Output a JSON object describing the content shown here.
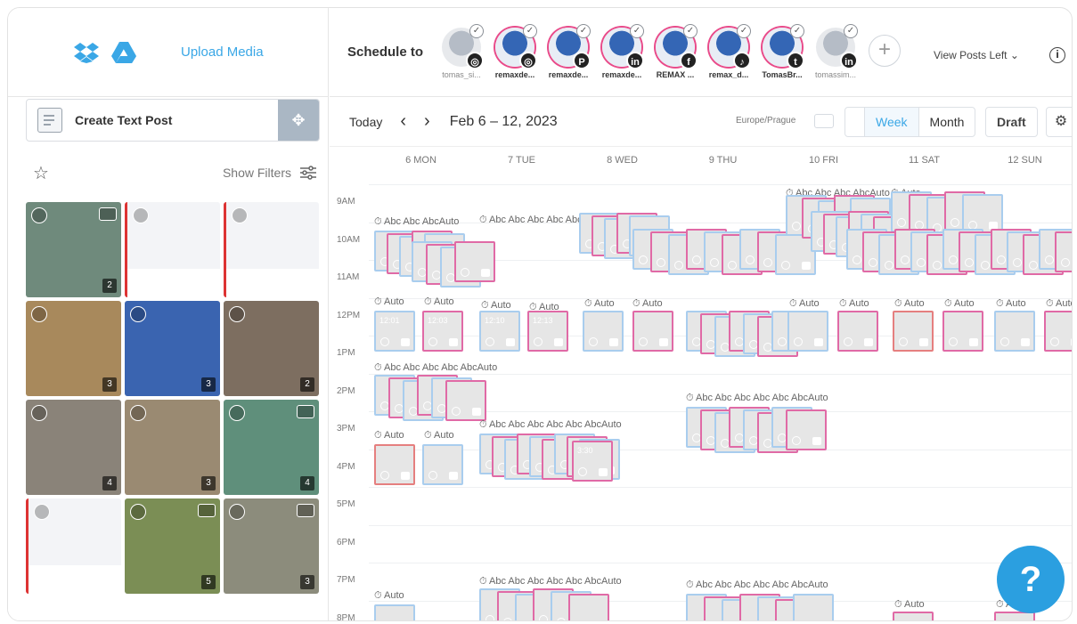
{
  "sidebar": {
    "upload_label": "Upload Media",
    "create_text_post": "Create Text Post",
    "show_filters": "Show Filters",
    "media_tiles": [
      {
        "count": "2",
        "video": true,
        "color": "#6f8a7c"
      },
      {
        "count": "",
        "video": false,
        "color": "#f3f4f7"
      },
      {
        "count": "",
        "video": false,
        "color": "#f3f4f7"
      },
      {
        "count": "3",
        "video": false,
        "color": "#a8895c"
      },
      {
        "count": "3",
        "video": false,
        "color": "#3a64b0"
      },
      {
        "count": "2",
        "video": false,
        "color": "#7d6e60"
      },
      {
        "count": "4",
        "video": false,
        "color": "#8a8379"
      },
      {
        "count": "3",
        "video": false,
        "color": "#9a8a72"
      },
      {
        "count": "4",
        "video": true,
        "color": "#5f8f7b"
      },
      {
        "count": "",
        "video": false,
        "color": "#f3f4f7"
      },
      {
        "count": "5",
        "video": true,
        "color": "#7b8e55"
      },
      {
        "count": "3",
        "video": true,
        "color": "#8c8c7c"
      }
    ]
  },
  "header": {
    "schedule_label": "Schedule to",
    "accounts": [
      {
        "name": "tomas_si...",
        "badge": "◎",
        "muted": true
      },
      {
        "name": "remaxde...",
        "badge": "◎",
        "muted": false
      },
      {
        "name": "remaxde...",
        "badge": "P",
        "muted": false
      },
      {
        "name": "remaxde...",
        "badge": "in",
        "muted": false
      },
      {
        "name": "REMAX ...",
        "badge": "f",
        "muted": false
      },
      {
        "name": "remax_d...",
        "badge": "♪",
        "muted": false
      },
      {
        "name": "TomasBr...",
        "badge": "t",
        "muted": false
      },
      {
        "name": "tomassim...",
        "badge": "in",
        "muted": true
      }
    ],
    "view_posts": "View Posts Left",
    "info_icon": "i"
  },
  "nav": {
    "today": "Today",
    "date_range": "Feb 6 – 12, 2023",
    "timezone": "Europe/Prague",
    "week": "Week",
    "month": "Month",
    "draft": "Draft"
  },
  "days": [
    "6 MON",
    "7 TUE",
    "8 WED",
    "9 THU",
    "10 FRI",
    "11 SAT",
    "12 SUN"
  ],
  "hours": [
    "9AM",
    "10AM",
    "11AM",
    "12PM",
    "1PM",
    "2PM",
    "3PM",
    "4PM",
    "5PM",
    "6PM",
    "7PM",
    "8PM"
  ],
  "auto_label": "Auto",
  "post_times": [
    "12:01",
    "12:03",
    "12:10",
    "12:13",
    "3:30"
  ],
  "help_icon": "?"
}
